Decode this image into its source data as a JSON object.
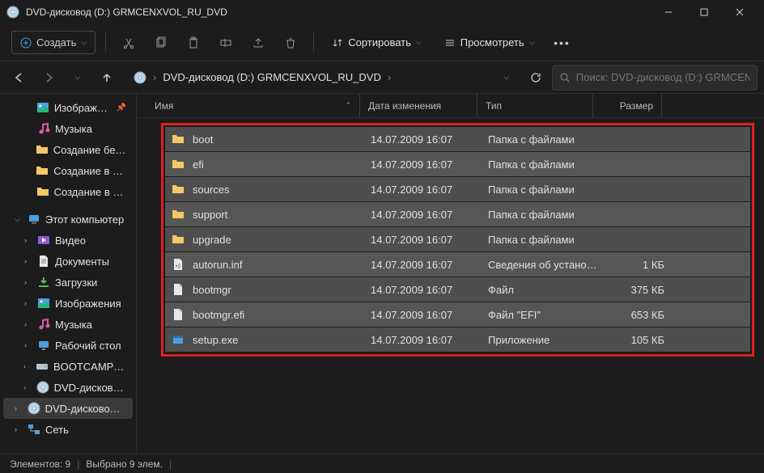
{
  "window": {
    "title": "DVD-дисковод (D:) GRMCENXVOL_RU_DVD"
  },
  "toolbar": {
    "create": "Создать",
    "sort": "Сортировать",
    "view": "Просмотреть"
  },
  "breadcrumb": {
    "path": "DVD-дисковод (D:) GRMCENXVOL_RU_DVD",
    "sep": "›"
  },
  "search": {
    "placeholder": "Поиск: DVD-дисковод (D:) GRMCENXVOL_RU…"
  },
  "sidebar": [
    {
      "label": "Изображени",
      "icon": "pictures",
      "indent": 1,
      "chev": "",
      "pinned": true
    },
    {
      "label": "Музыка",
      "icon": "music",
      "indent": 1,
      "chev": ""
    },
    {
      "label": "Создание без пр",
      "icon": "folder",
      "indent": 1,
      "chev": ""
    },
    {
      "label": "Создание в Mac",
      "icon": "folder",
      "indent": 1,
      "chev": ""
    },
    {
      "label": "Создание в Win",
      "icon": "folder",
      "indent": 1,
      "chev": ""
    },
    {
      "label": "Этот компьютер",
      "icon": "pc",
      "indent": 0,
      "chev": "v"
    },
    {
      "label": "Видео",
      "icon": "videos",
      "indent": 1,
      "chev": ">"
    },
    {
      "label": "Документы",
      "icon": "docs",
      "indent": 1,
      "chev": ">"
    },
    {
      "label": "Загрузки",
      "icon": "downloads",
      "indent": 1,
      "chev": ">"
    },
    {
      "label": "Изображения",
      "icon": "pictures",
      "indent": 1,
      "chev": ">"
    },
    {
      "label": "Музыка",
      "icon": "music",
      "indent": 1,
      "chev": ">"
    },
    {
      "label": "Рабочий стол",
      "icon": "desktop",
      "indent": 1,
      "chev": ">"
    },
    {
      "label": "BOOTCAMP (C:)",
      "icon": "drive",
      "indent": 1,
      "chev": ">"
    },
    {
      "label": "DVD-дисковод (",
      "icon": "dvd",
      "indent": 1,
      "chev": ">"
    },
    {
      "label": "DVD-дисковод (D",
      "icon": "dvd",
      "indent": 0,
      "chev": ">",
      "sel": true
    },
    {
      "label": "Сеть",
      "icon": "network",
      "indent": 0,
      "chev": ">"
    }
  ],
  "columns": {
    "name": "Имя",
    "date": "Дата изменения",
    "type": "Тип",
    "size": "Размер"
  },
  "files": [
    {
      "name": "boot",
      "date": "14.07.2009 16:07",
      "type": "Папка с файлами",
      "size": "",
      "icon": "folder"
    },
    {
      "name": "efi",
      "date": "14.07.2009 16:07",
      "type": "Папка с файлами",
      "size": "",
      "icon": "folder"
    },
    {
      "name": "sources",
      "date": "14.07.2009 16:07",
      "type": "Папка с файлами",
      "size": "",
      "icon": "folder"
    },
    {
      "name": "support",
      "date": "14.07.2009 16:07",
      "type": "Папка с файлами",
      "size": "",
      "icon": "folder"
    },
    {
      "name": "upgrade",
      "date": "14.07.2009 16:07",
      "type": "Папка с файлами",
      "size": "",
      "icon": "folder"
    },
    {
      "name": "autorun.inf",
      "date": "14.07.2009 16:07",
      "type": "Сведения об устано…",
      "size": "1 КБ",
      "icon": "inf"
    },
    {
      "name": "bootmgr",
      "date": "14.07.2009 16:07",
      "type": "Файл",
      "size": "375 КБ",
      "icon": "file"
    },
    {
      "name": "bootmgr.efi",
      "date": "14.07.2009 16:07",
      "type": "Файл \"EFI\"",
      "size": "653 КБ",
      "icon": "file"
    },
    {
      "name": "setup.exe",
      "date": "14.07.2009 16:07",
      "type": "Приложение",
      "size": "105 КБ",
      "icon": "exe"
    }
  ],
  "status": {
    "items": "Элементов: 9",
    "selected": "Выбрано 9 элем."
  }
}
